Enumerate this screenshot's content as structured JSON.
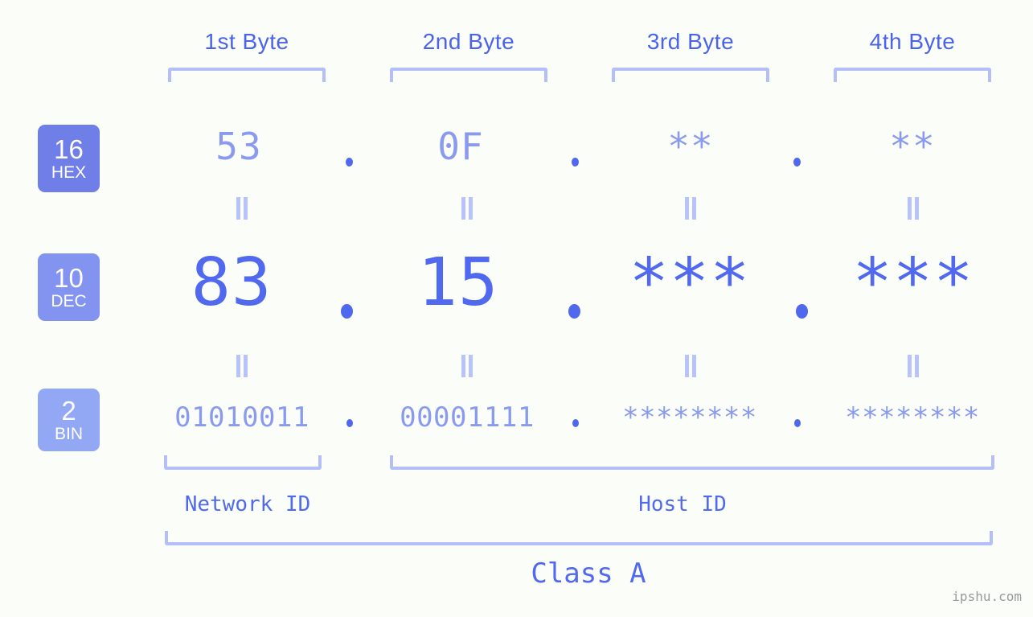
{
  "meta": {
    "background_color": "#fbfdf8",
    "accent_strong": "#5069ef",
    "accent_mid": "#8a9aef",
    "accent_light": "#b4bffa",
    "watermark": "ipshu.com"
  },
  "headers": [
    {
      "label": "1st Byte"
    },
    {
      "label": "2nd Byte"
    },
    {
      "label": "3rd Byte"
    },
    {
      "label": "4th Byte"
    }
  ],
  "rows": [
    {
      "key": "hex",
      "badge_number": "16",
      "badge_label": "HEX",
      "badge_color": "#6f7fe7",
      "values": [
        "53",
        "0F",
        "**",
        "**"
      ]
    },
    {
      "key": "dec",
      "badge_number": "10",
      "badge_label": "DEC",
      "badge_color": "#8293f0",
      "values": [
        "83",
        "15",
        "***",
        "***"
      ]
    },
    {
      "key": "bin",
      "badge_number": "2",
      "badge_label": "BIN",
      "badge_color": "#92a8f5",
      "values": [
        "01010011",
        "00001111",
        "********",
        "********"
      ]
    }
  ],
  "separator": ".",
  "equals_symbol": "=",
  "sections": {
    "network_id": "Network ID",
    "host_id": "Host ID",
    "class": "Class A"
  }
}
